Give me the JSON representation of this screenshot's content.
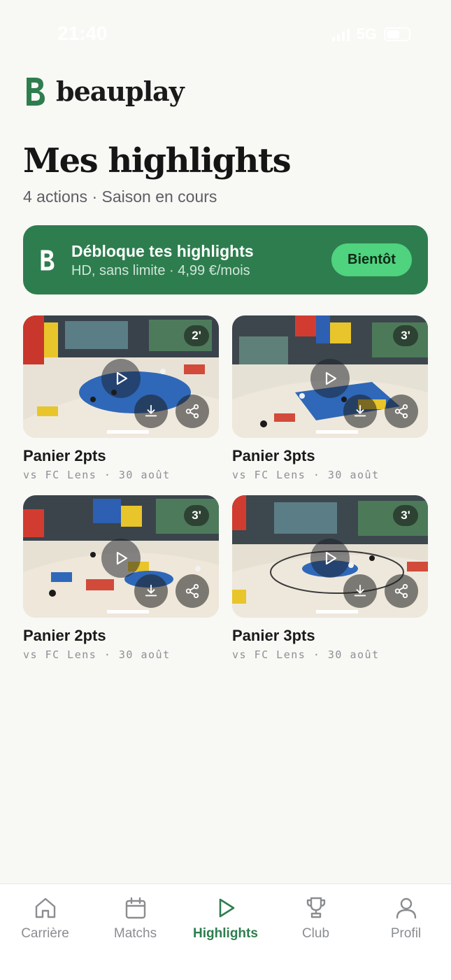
{
  "status": {
    "time": "21:40",
    "network": "5G",
    "battery_level": 0.6
  },
  "brand": {
    "name": "beauplay"
  },
  "page": {
    "title": "Mes highlights",
    "subtitle": "4 actions · Saison en cours"
  },
  "promo": {
    "title": "Débloque tes highlights",
    "subtitle": "HD, sans limite · 4,99 €/mois",
    "button_label": "Bientôt"
  },
  "highlights": [
    {
      "title": "Panier 2pts",
      "meta": "vs FC Lens · 30 août",
      "duration": "2'"
    },
    {
      "title": "Panier 3pts",
      "meta": "vs FC Lens · 30 août",
      "duration": "3'"
    },
    {
      "title": "Panier 2pts",
      "meta": "vs FC Lens · 30 août",
      "duration": "3'"
    },
    {
      "title": "Panier 3pts",
      "meta": "vs FC Lens · 30 août",
      "duration": "3'"
    }
  ],
  "tabs": [
    {
      "label": "Carrière",
      "icon": "home-icon",
      "active": false
    },
    {
      "label": "Matchs",
      "icon": "calendar-icon",
      "active": false
    },
    {
      "label": "Highlights",
      "icon": "play-icon",
      "active": true
    },
    {
      "label": "Club",
      "icon": "trophy-icon",
      "active": false
    },
    {
      "label": "Profil",
      "icon": "user-icon",
      "active": false
    }
  ],
  "colors": {
    "accent": "#2e7d4f",
    "accent_light": "#4fd37e",
    "background": "#f8f8f5"
  }
}
